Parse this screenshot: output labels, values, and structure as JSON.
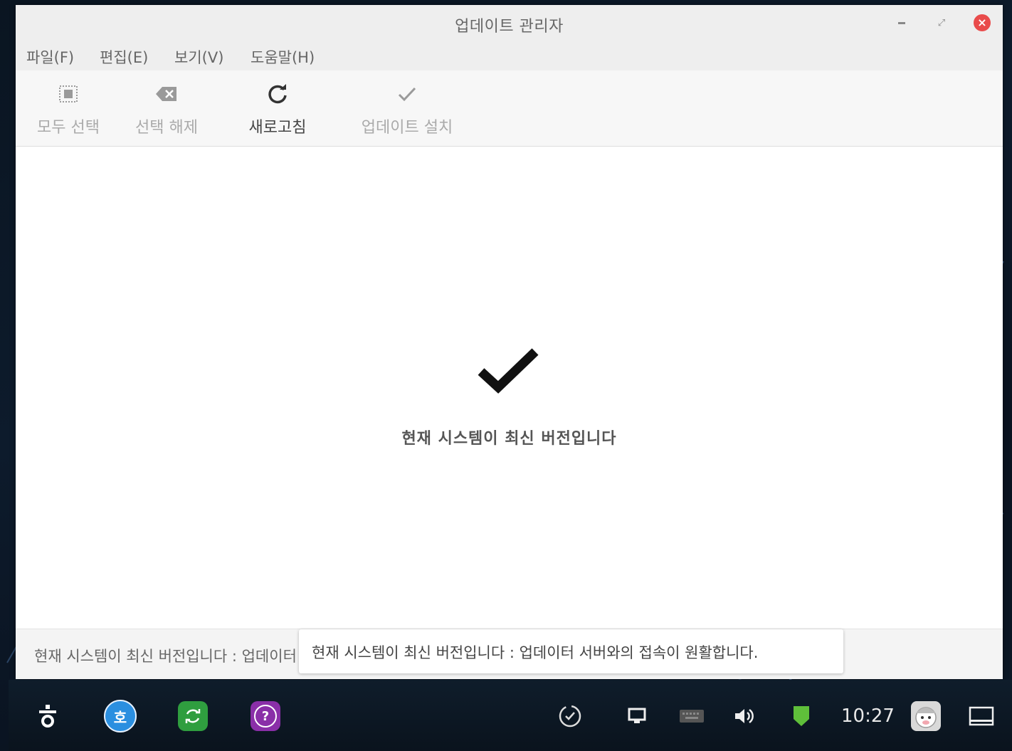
{
  "window": {
    "title": "업데이트 관리자",
    "controls": {
      "minimize": "minimize",
      "maximize": "maximize",
      "close": "close"
    }
  },
  "menu": [
    {
      "label": "파일(F)"
    },
    {
      "label": "편집(E)"
    },
    {
      "label": "보기(V)"
    },
    {
      "label": "도움말(H)"
    }
  ],
  "toolbar": {
    "select_all": {
      "label": "모두 선택",
      "icon": "select-all-icon",
      "enabled": false
    },
    "deselect": {
      "label": "선택 해제",
      "icon": "backspace-icon",
      "enabled": false
    },
    "refresh": {
      "label": "새로고침",
      "icon": "refresh-icon",
      "enabled": true
    },
    "install": {
      "label": "업데이트 설치",
      "icon": "check-icon",
      "enabled": false
    }
  },
  "content": {
    "message": "현재 시스템이 최신 버전입니다",
    "icon": "checkmark-icon"
  },
  "status": {
    "text": "현재 시스템이 최신 버전입니다 : 업데이터 서버와의 접속이 원활합니다.",
    "tooltip": "현재 시스템이 최신 버전입니다 : 업데이터 서버와의 접속이 원활합니다."
  },
  "taskbar": {
    "clock": "10:27",
    "apps": [
      {
        "name": "hangul-start-icon"
      },
      {
        "name": "hamonikr-icon",
        "glyph": "호",
        "color": "#2b8fe0"
      },
      {
        "name": "update-manager-icon",
        "color": "#2f9e3f"
      },
      {
        "name": "help-icon",
        "glyph": "?",
        "color": "#8a2fa8"
      }
    ],
    "tray": [
      "sync-icon",
      "display-icon",
      "keyboard-icon",
      "volume-icon",
      "shield-icon",
      "user-avatar-icon",
      "show-desktop-icon"
    ]
  },
  "colors": {
    "close": "#e94b4b",
    "shield": "#5fbf3a"
  }
}
